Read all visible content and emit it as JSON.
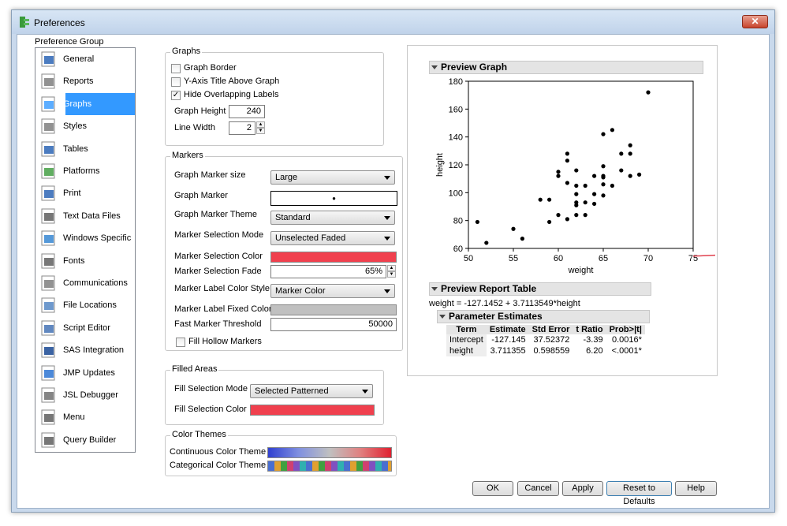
{
  "window": {
    "title": "Preferences",
    "close_label": "✕"
  },
  "preference_group": {
    "label": "Preference Group",
    "items": [
      {
        "label": "General",
        "icon": "general-icon"
      },
      {
        "label": "Reports",
        "icon": "reports-icon"
      },
      {
        "label": "Graphs",
        "icon": "graphs-icon",
        "selected": true
      },
      {
        "label": "Styles",
        "icon": "styles-icon"
      },
      {
        "label": "Tables",
        "icon": "tables-icon"
      },
      {
        "label": "Platforms",
        "icon": "platforms-icon"
      },
      {
        "label": "Print",
        "icon": "print-icon"
      },
      {
        "label": "Text Data Files",
        "icon": "text-data-files-icon"
      },
      {
        "label": "Windows Specific",
        "icon": "windows-specific-icon"
      },
      {
        "label": "Fonts",
        "icon": "fonts-icon"
      },
      {
        "label": "Communications",
        "icon": "communications-icon"
      },
      {
        "label": "File Locations",
        "icon": "file-locations-icon"
      },
      {
        "label": "Script Editor",
        "icon": "script-editor-icon"
      },
      {
        "label": "SAS Integration",
        "icon": "sas-integration-icon"
      },
      {
        "label": "JMP Updates",
        "icon": "jmp-updates-icon"
      },
      {
        "label": "JSL Debugger",
        "icon": "jsl-debugger-icon"
      },
      {
        "label": "Menu",
        "icon": "menu-icon"
      },
      {
        "label": "Query Builder",
        "icon": "query-builder-icon"
      }
    ]
  },
  "graphs": {
    "legend": "Graphs",
    "graph_border": {
      "label": "Graph Border",
      "checked": false
    },
    "y_axis_title": {
      "label": "Y-Axis Title Above Graph",
      "checked": false
    },
    "hide_overlapping": {
      "label": "Hide Overlapping Labels",
      "checked": true,
      "mark": "✓"
    },
    "graph_height": {
      "label": "Graph Height",
      "value": "240"
    },
    "line_width": {
      "label": "Line Width",
      "value": "2"
    }
  },
  "markers": {
    "legend": "Markers",
    "marker_size": {
      "label": "Graph Marker size",
      "value": "Large"
    },
    "graph_marker": {
      "label": "Graph Marker",
      "glyph": "●"
    },
    "marker_theme": {
      "label": "Graph Marker Theme",
      "value": "Standard"
    },
    "selection_mode": {
      "label": "Marker Selection Mode",
      "value": "Unselected Faded"
    },
    "selection_color": {
      "label": "Marker Selection Color",
      "color": "#f0404e"
    },
    "selection_fade": {
      "label": "Marker Selection Fade",
      "value": "65%"
    },
    "label_color_style": {
      "label": "Marker Label Color Style",
      "value": "Marker Color"
    },
    "label_fixed_color": {
      "label": "Marker Label Fixed Color",
      "color": "#c0c0c0"
    },
    "fast_threshold": {
      "label": "Fast Marker Threshold",
      "value": "50000"
    },
    "fill_hollow": {
      "label": "Fill Hollow Markers",
      "checked": false
    }
  },
  "filled_areas": {
    "legend": "Filled Areas",
    "fill_mode": {
      "label": "Fill Selection Mode",
      "value": "Selected Patterned"
    },
    "fill_color": {
      "label": "Fill Selection Color",
      "color": "#f0404e"
    }
  },
  "color_themes": {
    "legend": "Color Themes",
    "continuous": "Continuous Color Theme",
    "categorical": "Categorical Color Theme"
  },
  "preview": {
    "graph_title": "Preview Graph",
    "report_title": "Preview Report Table",
    "equation": "weight = -127.1452 + 3.7113549*height",
    "pe_title": "Parameter Estimates",
    "pe_headers": [
      "Term",
      "Estimate",
      "Std Error",
      "t Ratio",
      "Prob>|t|"
    ],
    "pe_rows": [
      [
        "Intercept",
        "-127.145",
        "37.52372",
        "-3.39",
        "0.0016*"
      ],
      [
        "height",
        "3.711355",
        "0.598559",
        "6.20",
        "<.0001*"
      ]
    ]
  },
  "chart_data": {
    "type": "scatter",
    "xlabel": "weight",
    "ylabel": "height",
    "xlim": [
      50,
      75
    ],
    "ylim": [
      60,
      180
    ],
    "xticks": [
      "50",
      "55",
      "60",
      "65",
      "70",
      "75"
    ],
    "yticks": [
      "60",
      "80",
      "100",
      "120",
      "140",
      "160",
      "180"
    ],
    "line_color": "#e0404e",
    "fit_line": {
      "intercept": -127.1452,
      "slope": 3.7113549
    },
    "points": [
      [
        51,
        79
      ],
      [
        52,
        64
      ],
      [
        55,
        74
      ],
      [
        56,
        67
      ],
      [
        58,
        95
      ],
      [
        59,
        79
      ],
      [
        59,
        95
      ],
      [
        60,
        84
      ],
      [
        60,
        112
      ],
      [
        60,
        115
      ],
      [
        61,
        107
      ],
      [
        61,
        123
      ],
      [
        61,
        128
      ],
      [
        61,
        81
      ],
      [
        62,
        84
      ],
      [
        62,
        91
      ],
      [
        62,
        93
      ],
      [
        62,
        99
      ],
      [
        62,
        105
      ],
      [
        62,
        116
      ],
      [
        63,
        84
      ],
      [
        63,
        93
      ],
      [
        63,
        105
      ],
      [
        64,
        92
      ],
      [
        64,
        99
      ],
      [
        64,
        112
      ],
      [
        65,
        98
      ],
      [
        65,
        106
      ],
      [
        65,
        111
      ],
      [
        65,
        112
      ],
      [
        65,
        119
      ],
      [
        65,
        142
      ],
      [
        66,
        105
      ],
      [
        66,
        145
      ],
      [
        67,
        116
      ],
      [
        67,
        128
      ],
      [
        68,
        112
      ],
      [
        68,
        128
      ],
      [
        68,
        134
      ],
      [
        69,
        113
      ],
      [
        70,
        172
      ]
    ]
  },
  "buttons": {
    "ok": "OK",
    "cancel": "Cancel",
    "apply": "Apply",
    "reset": "Reset to Defaults",
    "help": "Help"
  }
}
